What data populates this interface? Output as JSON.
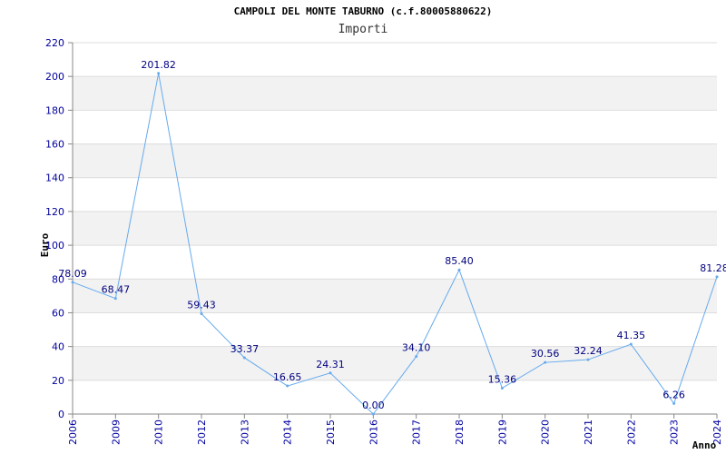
{
  "chart_data": {
    "type": "line",
    "title": "CAMPOLI DEL MONTE TABURNO (c.f.80005880622)",
    "subtitle": "Importi",
    "ylabel": "Euro",
    "xlabel": "Anno",
    "ylim": [
      0,
      220
    ],
    "yticks": [
      0,
      20,
      40,
      60,
      80,
      100,
      120,
      140,
      160,
      180,
      200,
      220
    ],
    "grid": true,
    "x": [
      "2006",
      "2009",
      "2010",
      "2012",
      "2013",
      "2014",
      "2015",
      "2016",
      "2017",
      "2018",
      "2019",
      "2020",
      "2021",
      "2022",
      "2023",
      "2024"
    ],
    "values": [
      78.09,
      68.47,
      201.82,
      59.43,
      33.37,
      16.65,
      24.31,
      0.0,
      34.1,
      85.4,
      15.36,
      30.56,
      32.24,
      41.35,
      6.26,
      81.28
    ],
    "value_labels": [
      "78.09",
      "68.47",
      "201.82",
      "59.43",
      "33.37",
      "16.65",
      "24.31",
      "0.00",
      "34.10",
      "85.40",
      "15.36",
      "30.56",
      "32.24",
      "41.35",
      "6.26",
      "81.28"
    ],
    "colors": {
      "line": "#66aaee",
      "band": "#f2f2f2",
      "grid": "#dddddd",
      "tick": "#0000a0"
    }
  }
}
